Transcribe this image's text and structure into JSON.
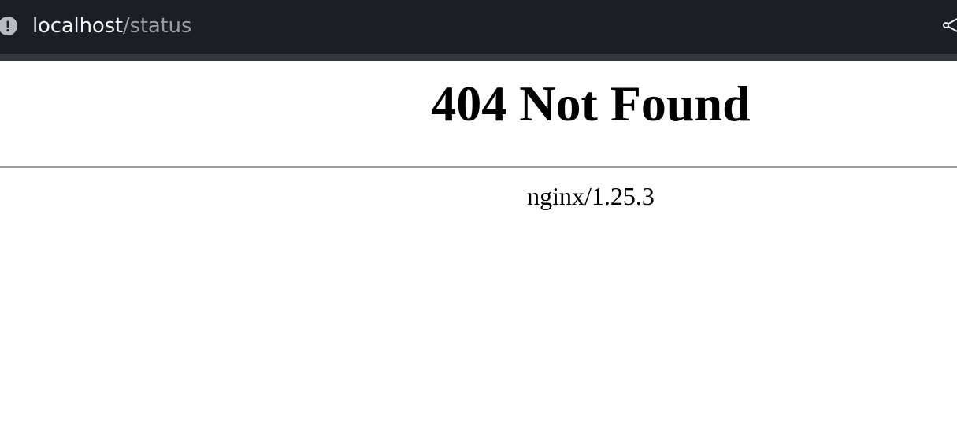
{
  "browser": {
    "url_host": "localhost",
    "url_path": "/status",
    "info_icon": "info-icon",
    "share_icon": "share-icon",
    "bar_color": "#1b1e24"
  },
  "page": {
    "heading": "404 Not Found",
    "server_signature": "nginx/1.25.3"
  }
}
